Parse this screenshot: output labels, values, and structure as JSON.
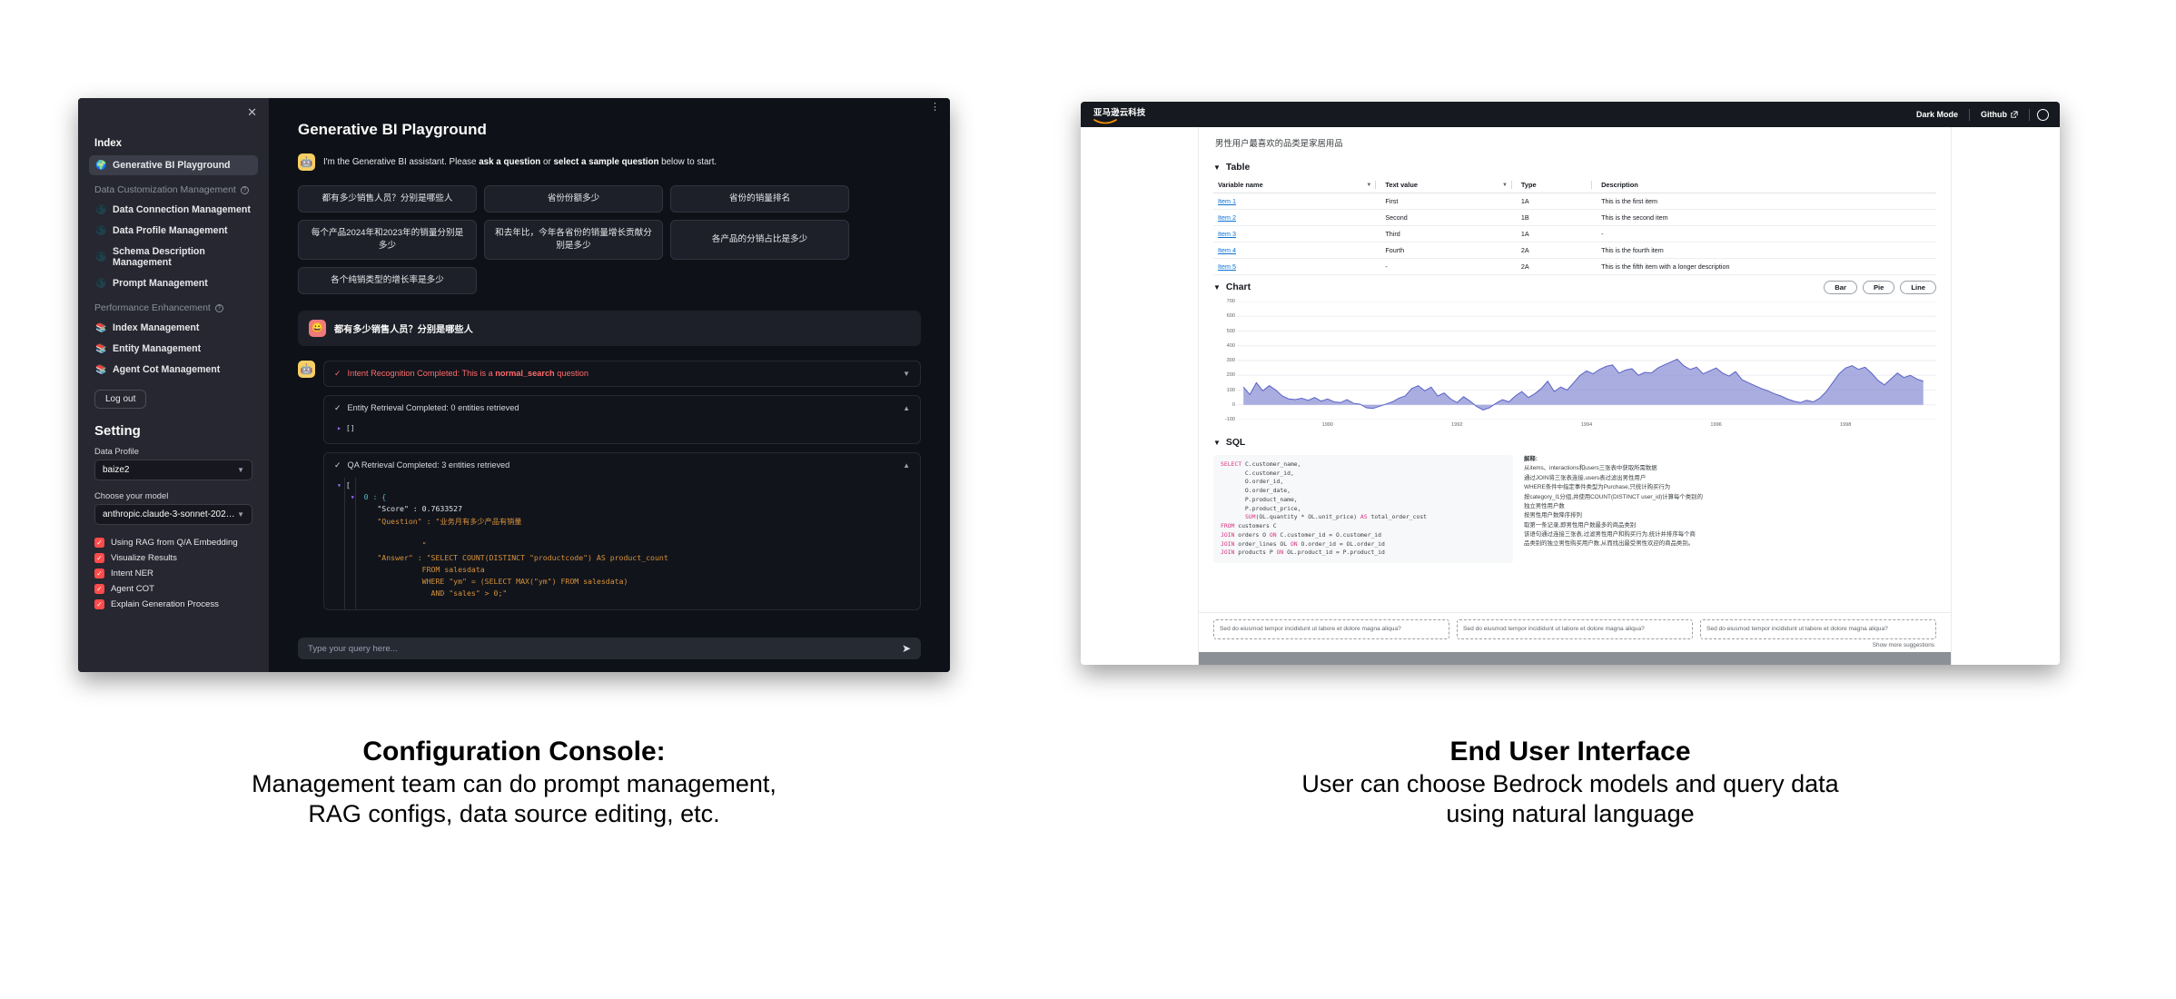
{
  "left_panel": {
    "sidebar": {
      "close_icon": "close-icon",
      "index_header": "Index",
      "index_items": [
        {
          "label": "Generative BI Playground",
          "emoji": "🌍",
          "active": true
        }
      ],
      "section_data": "Data Customization Management",
      "data_items": [
        {
          "label": "Data Connection Management",
          "emoji": "🌑"
        },
        {
          "label": "Data Profile Management",
          "emoji": "🌑"
        },
        {
          "label": "Schema Description Management",
          "emoji": "🌑"
        },
        {
          "label": "Prompt Management",
          "emoji": "🌑"
        }
      ],
      "section_perf": "Performance Enhancement",
      "perf_items": [
        {
          "label": "Index Management",
          "emoji": "📚"
        },
        {
          "label": "Entity Management",
          "emoji": "📚"
        },
        {
          "label": "Agent Cot Management",
          "emoji": "📚"
        }
      ],
      "logout": "Log out",
      "setting_title": "Setting",
      "data_profile_label": "Data Profile",
      "data_profile_value": "baize2",
      "model_label": "Choose your model",
      "model_value": "anthropic.claude-3-sonnet-202…",
      "checkboxes": [
        {
          "label": "Using RAG from Q/A Embedding",
          "checked": true
        },
        {
          "label": "Visualize Results",
          "checked": true
        },
        {
          "label": "Intent NER",
          "checked": true
        },
        {
          "label": "Agent COT",
          "checked": true
        },
        {
          "label": "Explain Generation Process",
          "checked": true
        }
      ]
    },
    "main": {
      "menu_icon": "more-vertical-icon",
      "title": "Generative BI Playground",
      "assistant_intro_pre": "I'm the Generative BI assistant. Please ",
      "assistant_intro_b1": "ask a question",
      "assistant_intro_mid": " or ",
      "assistant_intro_b2": "select a sample question",
      "assistant_intro_post": " below to start.",
      "sample_questions": [
        "都有多少销售人员？分别是哪些人",
        "省份份额多少",
        "省份的销量排名",
        "每个产品2024年和2023年的销量分别是多少",
        "和去年比，今年各省份的销量增长贡献分别是多少",
        "各产品的分销占比是多少",
        "各个纯销类型的增长率是多少"
      ],
      "user_message": "都有多少销售人员？分别是哪些人",
      "steps": [
        {
          "title_pre": "Intent Recognition Completed: This is a ",
          "title_b": "normal_search",
          "title_post": " question",
          "state": "collapsed",
          "tone": "intent"
        },
        {
          "title": "Entity Retrieval Completed: 0 entities retrieved",
          "state": "expanded",
          "tone": "neutral",
          "body": "[]"
        },
        {
          "title": "QA Retrieval Completed: 3 entities retrieved",
          "state": "expanded",
          "tone": "neutral"
        }
      ],
      "qa_code_lines": [
        "[",
        "  0 : {",
        "    \"Score\" : 0.7633527",
        "    \"Question\" : \"业务月有多少产品有销量",
        "",
        "              \"",
        "    \"Answer\" : \"SELECT COUNT(DISTINCT \"productcode\") AS product_count",
        "              FROM salesdata",
        "              WHERE \"ym\" = (SELECT MAX(\"ym\") FROM salesdata)",
        "                AND \"sales\" > 0;\""
      ],
      "input_placeholder": "Type your query here...",
      "input_value": "",
      "send_icon": "send-icon"
    }
  },
  "right_panel": {
    "header": {
      "brand": "亚马逊云科技",
      "dark_mode": "Dark Mode",
      "github": "Github",
      "github_external_icon": "external-link-icon",
      "settings_icon": "gear-icon"
    },
    "answer_title": "男性用户最喜欢的品类是家居用品",
    "table_section": {
      "heading": "Table",
      "columns": [
        "Variable name",
        "Text value",
        "Type",
        "Description"
      ],
      "rows": [
        {
          "name": "Item 1",
          "text": "First",
          "type": "1A",
          "desc": "This is the first item"
        },
        {
          "name": "Item 2",
          "text": "Second",
          "type": "1B",
          "desc": "This is the second item"
        },
        {
          "name": "Item 3",
          "text": "Third",
          "type": "1A",
          "desc": "-"
        },
        {
          "name": "Item 4",
          "text": "Fourth",
          "type": "2A",
          "desc": "This is the fourth item"
        },
        {
          "name": "Item 5",
          "text": "-",
          "type": "2A",
          "desc": "This is the fifth item with a longer description"
        }
      ]
    },
    "chart_section": {
      "heading": "Chart",
      "buttons": [
        "Bar",
        "Pie",
        "Line"
      ]
    },
    "sql_section": {
      "heading": "SQL",
      "sql_lines": [
        "SELECT C.customer_name,",
        "       C.customer_id,",
        "       O.order_id,",
        "       O.order_date,",
        "       P.product_name,",
        "       P.product_price,",
        "       SUM(OL.quantity * OL.unit_price) AS total_order_cost",
        "FROM customers C",
        "JOIN orders O ON C.customer_id = O.customer_id",
        "JOIN order_lines OL ON O.order_id = OL.order_id",
        "JOIN products P ON OL.product_id = P.product_id"
      ],
      "explanation_heading": "解释:",
      "explanation_lines": [
        "从items、interactions和users三张表中获取所需数据",
        "通过JOIN将三张表连接,users表过滤出男性用户",
        "WHERE条件中指定事件类型为Purchase,只统计购买行为",
        "按category_l1分组,并使用COUNT(DISTINCT user_id)计算每个类别的",
        "独立男性用户数",
        "按男性用户数降序排列",
        "取第一条记录,即男性用户数最多的商品类别",
        "该语句通过连接三张表,过滤男性用户和购买行为,统计并排序每个商",
        "品类别的独立男性购买用户数,从而找出最受男性欢迎的商品类别。"
      ]
    },
    "suggestions": [
      "Sed do eiusmod tempor incididunt ut labore et dolore magna aliqua?",
      "Sed do eiusmod tempor incididunt ut labore et dolore magna aliqua?",
      "Sed do eiusmod tempor incididunt ut labore et dolore magna aliqua?"
    ],
    "show_more": "Show more suggestions"
  },
  "captions": {
    "left_title": "Configuration Console:",
    "left_line1": "Management team can do prompt management,",
    "left_line2": "RAG configs, data source editing, etc.",
    "right_title": "End User Interface",
    "right_line1": "User can choose Bedrock models and query data",
    "right_line2": "using natural language"
  },
  "chart_data": {
    "type": "area",
    "title": "Chart",
    "xlabel": "",
    "ylabel": "",
    "ylim": [
      -100,
      700
    ],
    "yticks": [
      700,
      600,
      500,
      400,
      300,
      200,
      100,
      0,
      -100
    ],
    "xlim": [
      1988.6,
      1999.4
    ],
    "xticks": [
      1990,
      1992,
      1994,
      1996,
      1998
    ],
    "grid": true,
    "legend": "none",
    "series": [
      {
        "name": "value",
        "color": "#8c92d6",
        "x": [
          1988.7,
          1988.8,
          1988.9,
          1989.0,
          1989.1,
          1989.2,
          1989.3,
          1989.4,
          1989.5,
          1989.6,
          1989.7,
          1989.8,
          1989.9,
          1990.0,
          1990.1,
          1990.2,
          1990.3,
          1990.4,
          1990.5,
          1990.6,
          1990.7,
          1990.8,
          1990.9,
          1991.0,
          1991.1,
          1991.2,
          1991.3,
          1991.4,
          1991.5,
          1991.6,
          1991.7,
          1991.8,
          1991.9,
          1992.0,
          1992.1,
          1992.2,
          1992.3,
          1992.4,
          1992.5,
          1992.6,
          1992.7,
          1992.8,
          1992.9,
          1993.0,
          1993.1,
          1993.2,
          1993.3,
          1993.4,
          1993.5,
          1993.6,
          1993.7,
          1993.8,
          1993.9,
          1994.0,
          1994.1,
          1994.2,
          1994.3,
          1994.4,
          1994.5,
          1994.6,
          1994.7,
          1994.8,
          1994.9,
          1995.0,
          1995.1,
          1995.2,
          1995.3,
          1995.4,
          1995.5,
          1995.6,
          1995.7,
          1995.8,
          1995.9,
          1996.0,
          1996.1,
          1996.2,
          1996.3,
          1996.4,
          1996.5,
          1996.6,
          1996.7,
          1996.8,
          1996.9,
          1997.0,
          1997.1,
          1997.2,
          1997.3,
          1997.4,
          1997.5,
          1997.6,
          1997.7,
          1997.8,
          1997.9,
          1998.0,
          1998.1,
          1998.2,
          1998.3,
          1998.4,
          1998.5,
          1998.6,
          1998.7,
          1998.8,
          1998.9,
          1999.0,
          1999.1,
          1999.2
        ],
        "y": [
          120,
          70,
          150,
          95,
          130,
          100,
          60,
          40,
          35,
          45,
          30,
          50,
          25,
          40,
          20,
          15,
          35,
          10,
          5,
          -20,
          -25,
          -10,
          5,
          20,
          45,
          60,
          110,
          130,
          95,
          120,
          60,
          80,
          40,
          15,
          55,
          25,
          -10,
          -35,
          -20,
          10,
          35,
          20,
          60,
          90,
          50,
          75,
          110,
          160,
          90,
          120,
          100,
          150,
          200,
          230,
          210,
          240,
          260,
          270,
          215,
          235,
          245,
          200,
          220,
          215,
          250,
          270,
          290,
          310,
          265,
          240,
          255,
          210,
          230,
          250,
          215,
          195,
          225,
          170,
          150,
          130,
          110,
          95,
          75,
          60,
          40,
          25,
          15,
          30,
          20,
          45,
          90,
          150,
          210,
          250,
          265,
          240,
          255,
          215,
          165,
          135,
          175,
          215,
          185,
          200,
          175,
          160
        ]
      }
    ]
  }
}
